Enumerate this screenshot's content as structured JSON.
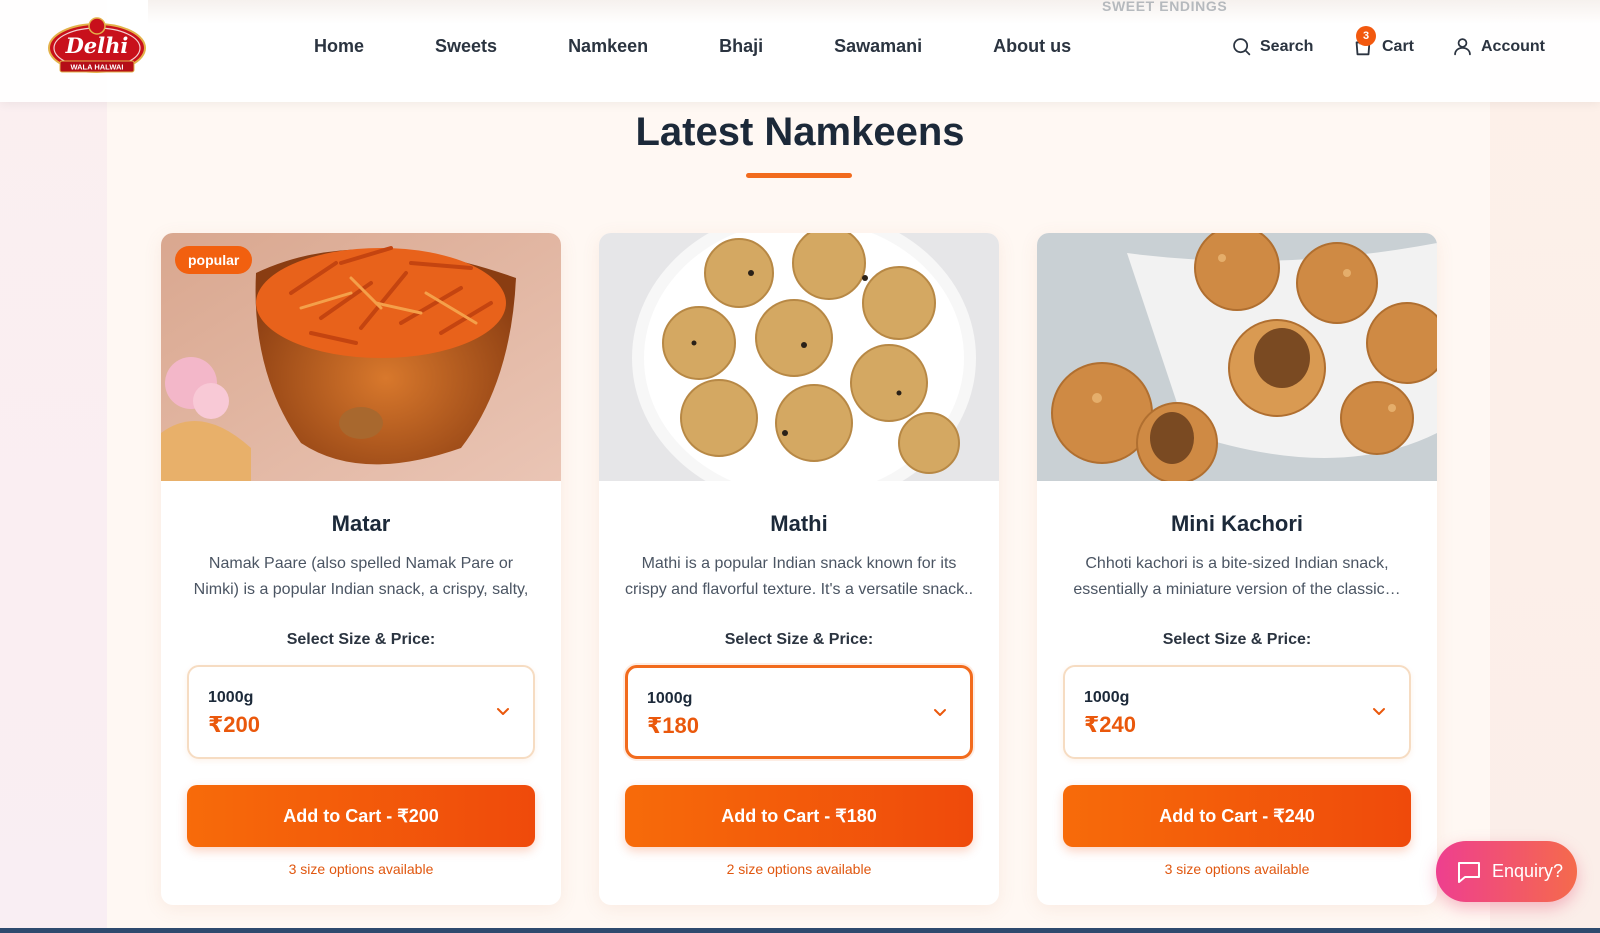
{
  "header": {
    "brand": {
      "name": "Delhi",
      "tagline": "WALA HALWAI"
    },
    "ghost_banner": "SWEET ENDINGS",
    "nav": [
      "Home",
      "Sweets",
      "Namkeen",
      "Bhaji",
      "Sawamani",
      "About us"
    ],
    "search_label": "Search",
    "cart_label": "Cart",
    "cart_count": "3",
    "account_label": "Account",
    "icons": {
      "search": "search-icon",
      "cart": "shopping-bag-icon",
      "account": "user-icon"
    }
  },
  "section": {
    "title": "Latest Namkeens"
  },
  "products": [
    {
      "badge": "popular",
      "name": "Matar",
      "description": "Namak Paare (also spelled Namak Pare or Nimki) is a popular Indian snack, a crispy, salty, and oft…",
      "select_label": "Select Size & Price:",
      "size": "1000g",
      "price": "₹200",
      "button_label": "Add to Cart - ₹200",
      "options_note": "3 size options available"
    },
    {
      "badge": "",
      "name": "Mathi",
      "description": "Mathi is a popular Indian snack known for its crispy and flavorful texture. It's a versatile snack..",
      "select_label": "Select Size & Price:",
      "size": "1000g",
      "price": "₹180",
      "button_label": "Add to Cart - ₹180",
      "options_note": "2 size options available"
    },
    {
      "badge": "",
      "name": "Mini Kachori",
      "description": "Chhoti kachori is a bite-sized Indian snack, essentially a miniature version of the classic…",
      "select_label": "Select Size & Price:",
      "size": "1000g",
      "price": "₹240",
      "button_label": "Add to Cart - ₹240",
      "options_note": "3 size options available"
    }
  ],
  "enquiry": {
    "label": "Enquiry?",
    "icon": "chat-bubble-icon"
  },
  "colors": {
    "accent": "#f26b1d",
    "price": "#ea580c",
    "heading": "#1c2939",
    "enquiry": "#ee3f8f"
  }
}
